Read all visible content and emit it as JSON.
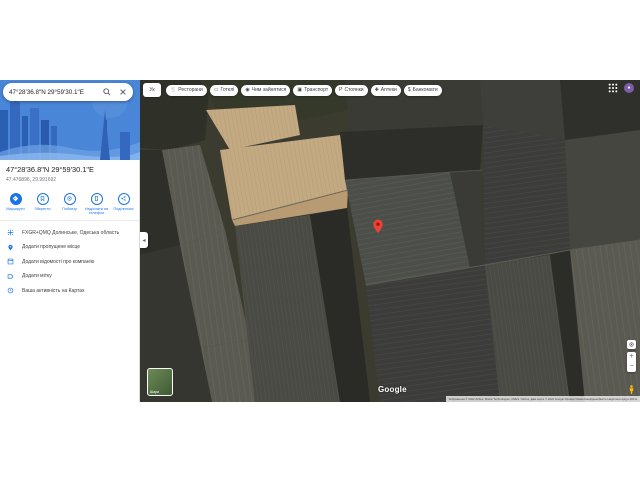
{
  "search": {
    "value": "47°28'36.8\"N 29°59'30.1\"E"
  },
  "place": {
    "title": "47°28'36.8\"N 29°59'30.1\"E",
    "subtitle": "47.476896, 29.991692"
  },
  "actions": [
    {
      "label": "Маршрути",
      "icon": "directions-icon"
    },
    {
      "label": "Зберегти",
      "icon": "bookmark-icon"
    },
    {
      "label": "Поблизу",
      "icon": "nearby-icon"
    },
    {
      "label": "Надіслати на телефон",
      "icon": "send-to-phone-icon"
    },
    {
      "label": "Поділитися",
      "icon": "share-icon"
    }
  ],
  "info": [
    {
      "text": "FXGR+QMQ Долинське, Одеська область",
      "icon": "plus-code-icon"
    },
    {
      "text": "Додати пропущене місце",
      "icon": "add-place-icon"
    },
    {
      "text": "Додати відомості про компанію",
      "icon": "business-icon"
    },
    {
      "text": "Додати мітку",
      "icon": "label-icon"
    },
    {
      "text": "Ваша активність на Картах",
      "icon": "history-icon"
    }
  ],
  "chips_menu": "Ук",
  "chips": [
    {
      "label": "Ресторани",
      "icon": "restaurant-icon"
    },
    {
      "label": "Готелі",
      "icon": "hotel-icon"
    },
    {
      "label": "Чим зайнятися",
      "icon": "camera-icon"
    },
    {
      "label": "Транспорт",
      "icon": "transit-icon"
    },
    {
      "label": "Стоянки",
      "icon": "parking-icon"
    },
    {
      "label": "Аптеки",
      "icon": "pharmacy-icon"
    },
    {
      "label": "Банкомати",
      "icon": "atm-icon"
    }
  ],
  "layers_label": "Шари",
  "logo": "Google",
  "attribution": "Зображення © 2022 Airbus, Maxar Technologies, CNES / Airbus, Дані карти © 2022 Google   Україна   Умови   Конфіденційність   Надіслати відгук   200 м",
  "colors": {
    "accent": "#1a73e8",
    "pin": "#ea4335"
  }
}
